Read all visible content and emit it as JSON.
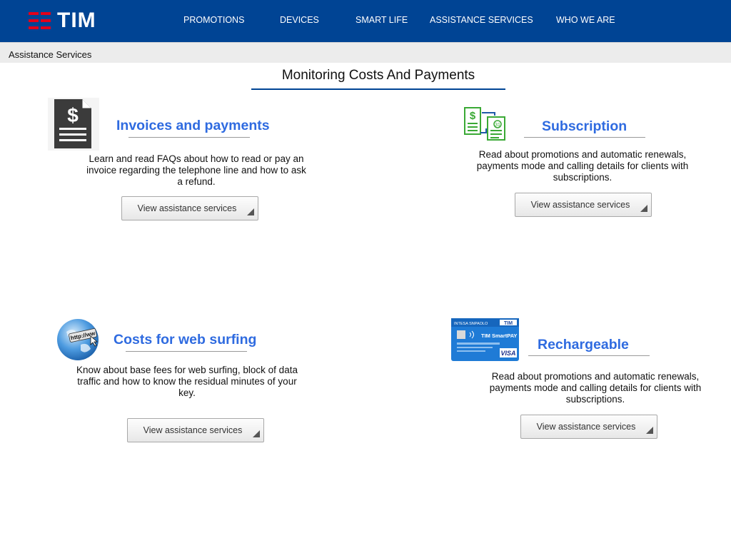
{
  "header": {
    "brand": "TIM",
    "nav": [
      "PROMOTIONS",
      "DEVICES",
      "SMART LIFE",
      "ASSISTANCE SERVICES",
      "WHO WE ARE"
    ]
  },
  "breadcrumb": "Assistance Services",
  "page_title": "Monitoring Costs And Payments",
  "cards": [
    {
      "title": "Invoices and payments",
      "description": "Learn and read FAQs about how to read or pay an invoice regarding the telephone line and how to ask a refund.",
      "button": "View assistance services",
      "icon": "invoice-dollar-icon"
    },
    {
      "title": "Subscription",
      "description": "Read about promotions and automatic renewals, payments mode and calling details for clients with subscriptions.",
      "button": "View assistance services",
      "icon": "subscription-documents-icon"
    },
    {
      "title": "Costs for web surfing",
      "description": "Know about base fees for web surfing, block of data traffic and how to know the residual minutes of your key.",
      "button": "View assistance services",
      "icon": "globe-http-icon"
    },
    {
      "title": "Rechargeable",
      "description": "Read about promotions and automatic renewals, payments mode and calling details for clients with subscriptions.",
      "button": "View assistance services",
      "icon": "smartpay-card-icon"
    }
  ],
  "card_image_text": {
    "bank": "INTESA SNPAOLO",
    "brand": "TIM",
    "product": "TIM SmartPAY",
    "network": "VISA",
    "url_label": "http://ww"
  },
  "colors": {
    "header_bg": "#004494",
    "logo_red": "#e2001a",
    "link_blue": "#2f6be0",
    "breadcrumb_bg": "#ececec",
    "icon_green": "#3aa935"
  }
}
